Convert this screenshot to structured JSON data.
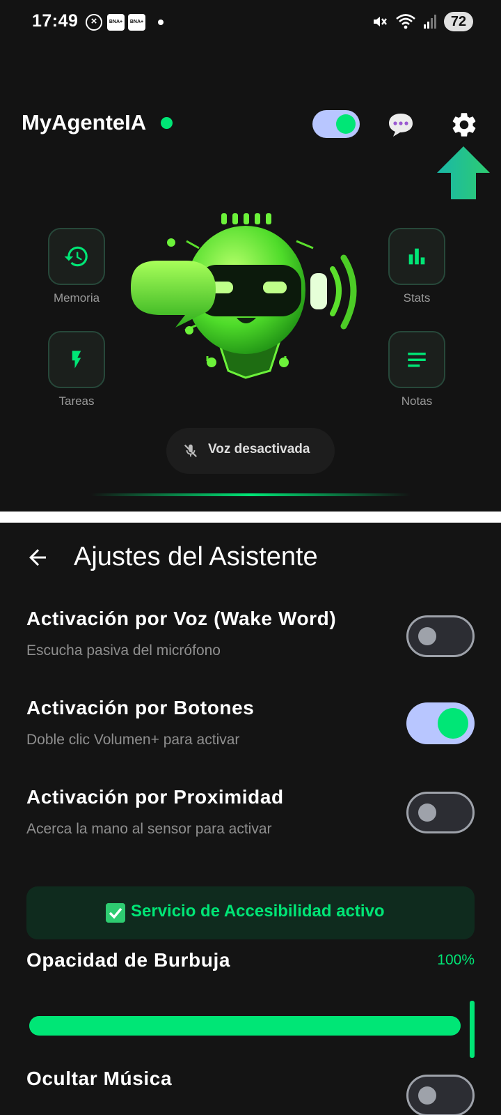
{
  "status_bar": {
    "time": "17:49",
    "badge_1": "BNA+",
    "badge_2": "BNA+",
    "battery": "72"
  },
  "home": {
    "app_title": "MyAgenteIA",
    "tiles": {
      "memoria": "Memoria",
      "tareas": "Tareas",
      "stats": "Stats",
      "notas": "Notas"
    },
    "voice_status": "Voz desactivada",
    "assistant_enabled": true
  },
  "settings": {
    "title": "Ajustes del Asistente",
    "rows": [
      {
        "title": "Activación por Voz (Wake Word)",
        "subtitle": "Escucha pasiva del micrófono",
        "enabled": false
      },
      {
        "title": "Activación por Botones",
        "subtitle": "Doble clic Volumen+ para activar",
        "enabled": true
      },
      {
        "title": "Activación por Proximidad",
        "subtitle": "Acerca la mano al sensor para activar",
        "enabled": false
      }
    ],
    "accessibility_status": "Servicio de Accesibilidad activo",
    "opacity_label": "Opacidad de Burbuja",
    "opacity_value_text": "100%",
    "opacity_value": 1.0,
    "hide_music_label": "Ocultar Música"
  },
  "colors": {
    "accent": "#00e676",
    "toggle_track_on": "#b8c6ff",
    "background": "#131313"
  }
}
